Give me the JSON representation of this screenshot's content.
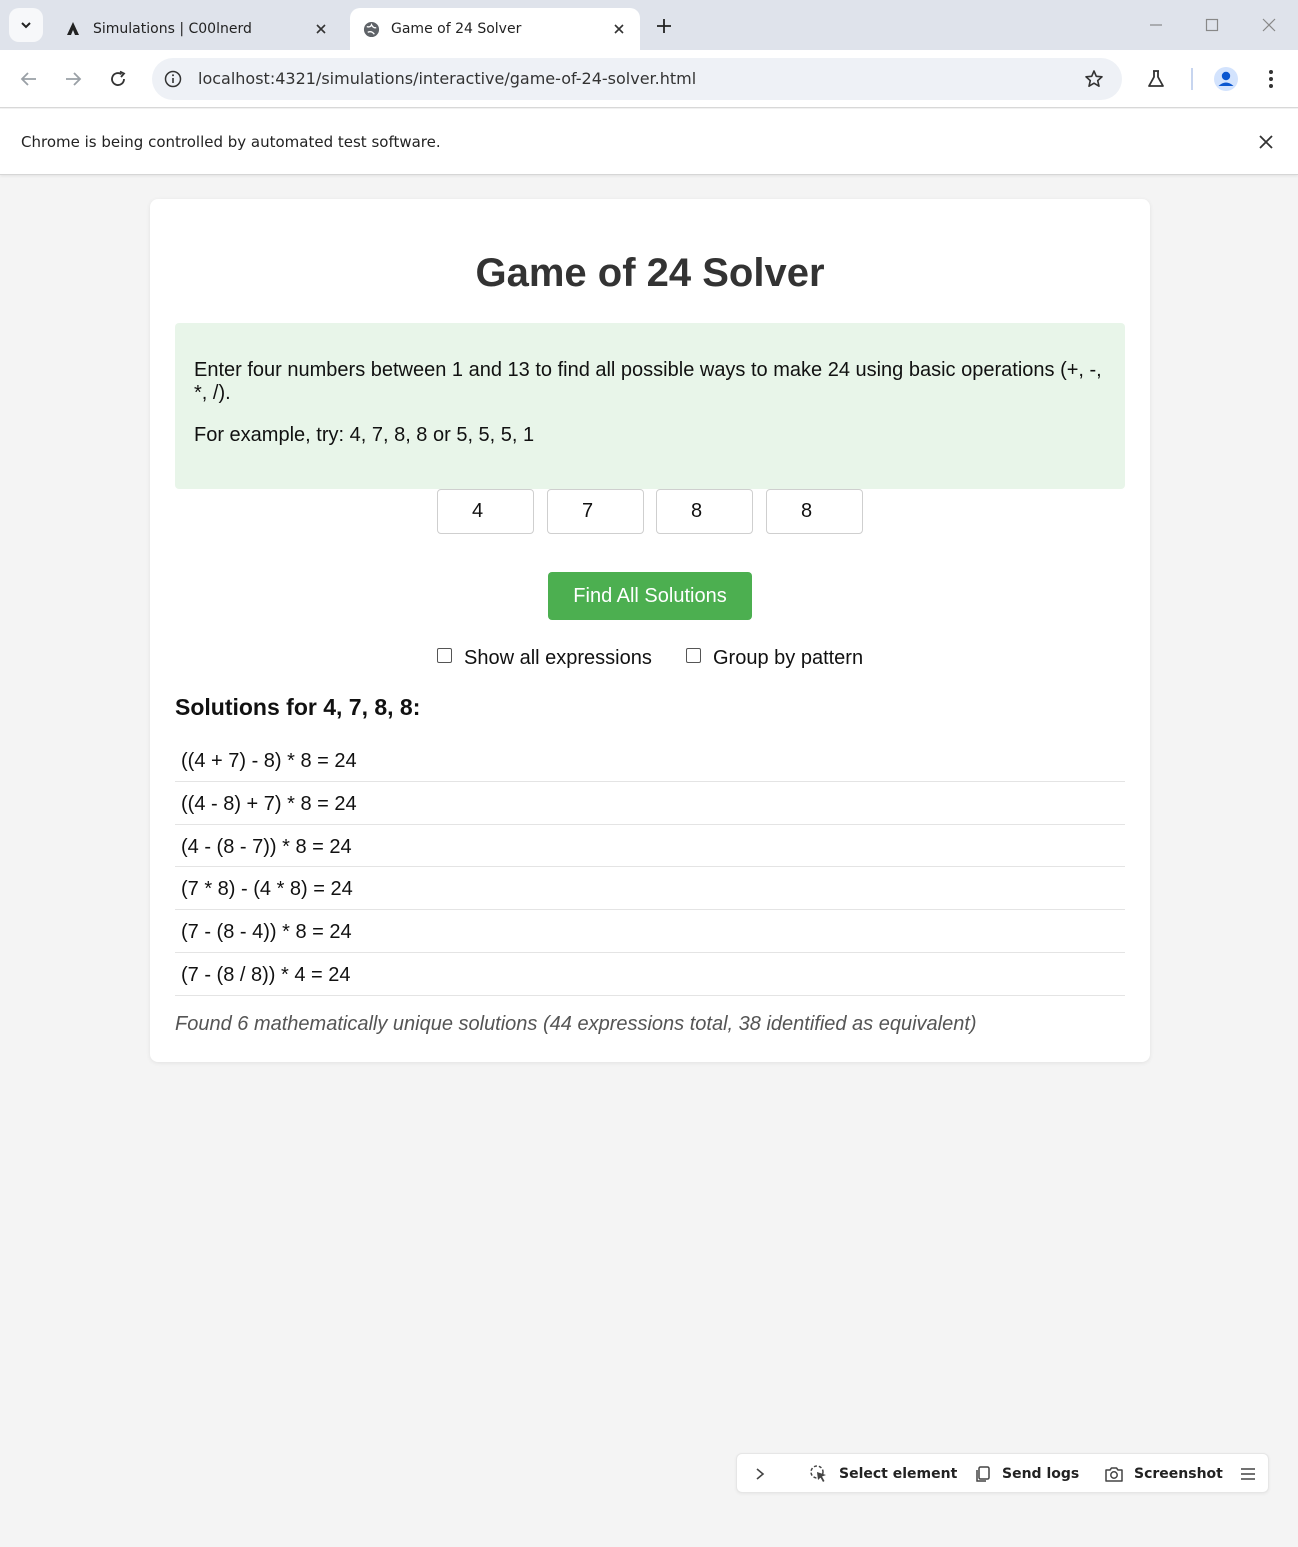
{
  "browser": {
    "tabs": [
      {
        "title": "Simulations | C00lnerd",
        "active": false
      },
      {
        "title": "Game of 24 Solver",
        "active": true
      }
    ],
    "url": "localhost:4321/simulations/interactive/game-of-24-solver.html",
    "infobar_message": "Chrome is being controlled by automated test software."
  },
  "page": {
    "title": "Game of 24 Solver",
    "intro": {
      "line1": "Enter four numbers between 1 and 13 to find all possible ways to make 24 using basic operations (+, -, *, /).",
      "line2": "For example, try: 4, 7, 8, 8 or 5, 5, 5, 1"
    },
    "inputs": [
      "4",
      "7",
      "8",
      "8"
    ],
    "find_button": "Find All Solutions",
    "options": {
      "show_all": {
        "label": "Show all expressions",
        "checked": false
      },
      "group_by": {
        "label": "Group by pattern",
        "checked": false
      }
    },
    "solutions_heading": "Solutions for 4, 7, 8, 8:",
    "solutions": [
      "((4 + 7) - 8) * 8 = 24",
      "((4 - 8) + 7) * 8 = 24",
      "(4 - (8 - 7)) * 8 = 24",
      "(7 * 8) - (4 * 8) = 24",
      "(7 - (8 - 4)) * 8 = 24",
      "(7 - (8 / 8)) * 4 = 24"
    ],
    "summary": "Found 6 mathematically unique solutions (44 expressions total, 38 identified as equivalent)"
  },
  "bottombar": {
    "select_element": "Select element",
    "send_logs": "Send logs",
    "screenshot": "Screenshot"
  },
  "colors": {
    "accent_green": "#4caf50",
    "intro_background": "#e8f5e9",
    "page_background": "#f4f4f4"
  }
}
